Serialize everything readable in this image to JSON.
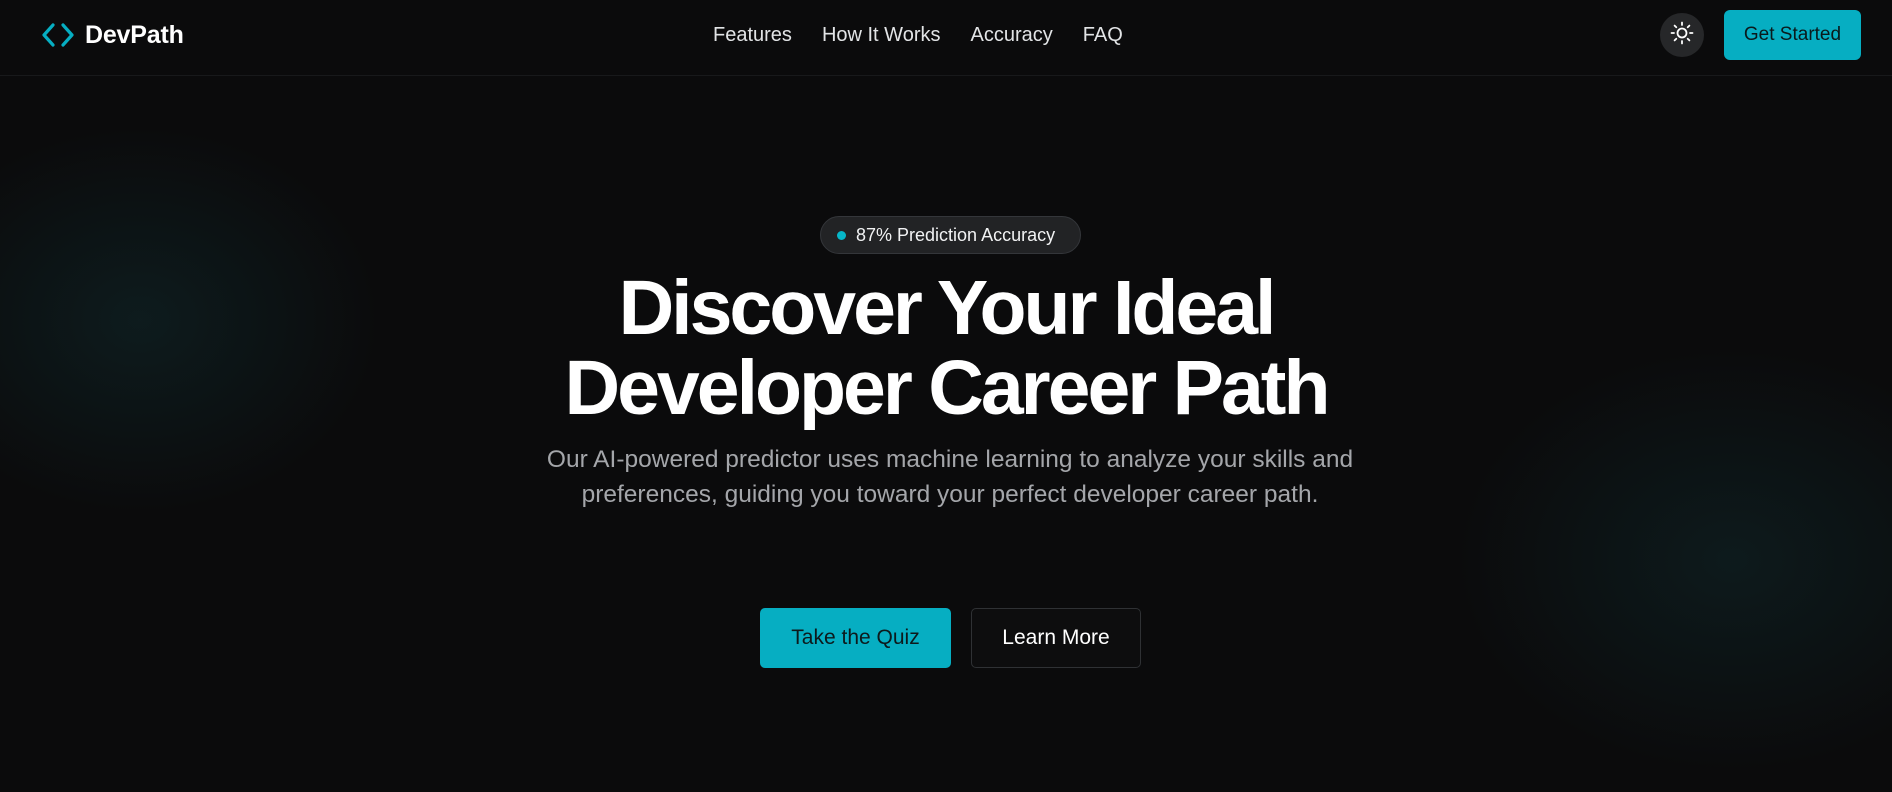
{
  "header": {
    "logo_text": "DevPath",
    "logo_icon": "code-brackets-icon",
    "nav": [
      {
        "label": "Features"
      },
      {
        "label": "How It Works"
      },
      {
        "label": "Accuracy"
      },
      {
        "label": "FAQ"
      }
    ],
    "theme_icon": "sun-icon",
    "cta_label": "Get Started"
  },
  "hero": {
    "badge_text": "87% Prediction Accuracy",
    "title_line1": "Discover Your Ideal",
    "title_line2": "Developer Career Path",
    "subtitle": "Our AI-powered predictor uses machine learning to analyze your skills and preferences, guiding you toward your perfect developer career path.",
    "primary_button": "Take the Quiz",
    "secondary_button": "Learn More"
  },
  "colors": {
    "accent": "#06aec2",
    "background": "#0b0b0c"
  }
}
